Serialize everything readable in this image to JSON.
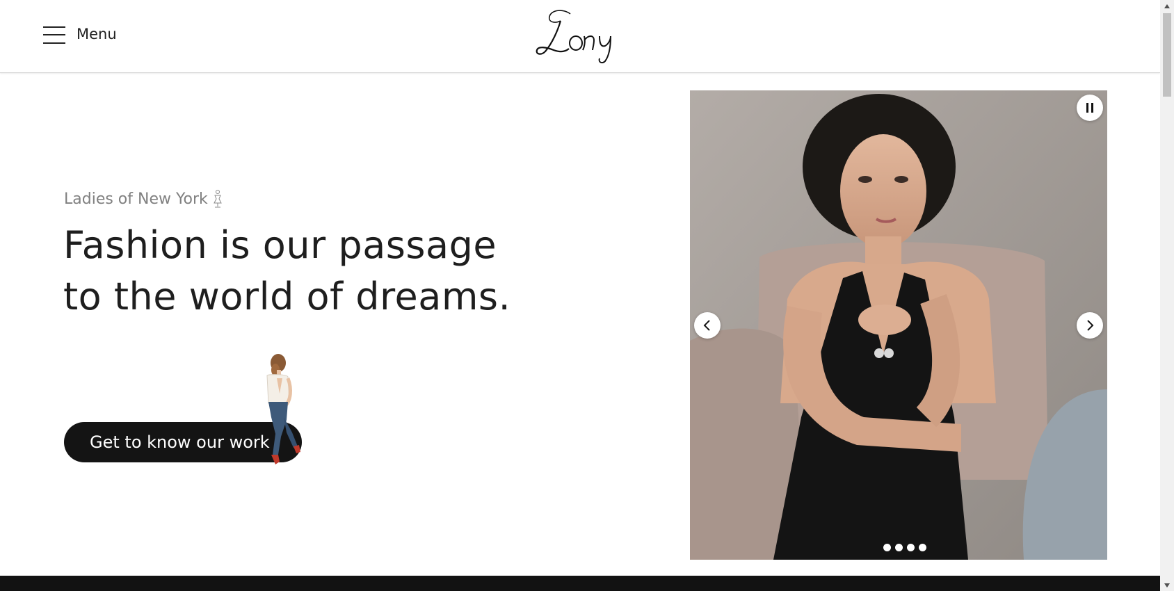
{
  "header": {
    "menu_label": "Menu",
    "logo_text": "Lony"
  },
  "hero": {
    "eyebrow": "Ladies of New York",
    "headline_lines": [
      "Fashion is our passage",
      "to the world of dreams."
    ],
    "cta_label": "Get to know our work"
  },
  "slider": {
    "slide_count": 4,
    "active_slide": 1,
    "controls": {
      "pause_icon": "pause-icon",
      "prev_icon": "chevron-left-icon",
      "next_icon": "chevron-right-icon"
    }
  },
  "colors": {
    "accent": "#141414",
    "eyebrow_gray": "#808080",
    "footer_strip": "#121212"
  }
}
